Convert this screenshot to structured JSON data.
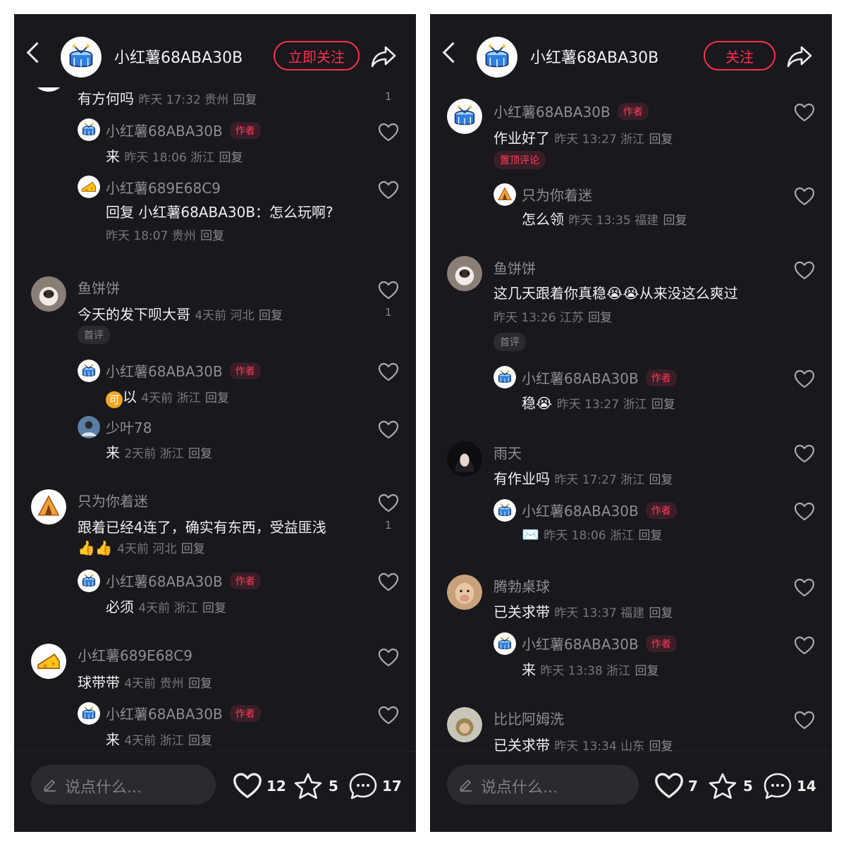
{
  "common": {
    "reply_label": "回复",
    "author_tag": "作者"
  },
  "left": {
    "header": {
      "title": "小红薯68ABA30B",
      "follow_label": "立即关注"
    },
    "comments": [
      {
        "name": "",
        "text": "有方何吗",
        "time": "昨天 17:32 贵州",
        "likes": "1"
      },
      {
        "name": "小红薯68ABA30B",
        "text": "来",
        "time": "昨天 18:06 浙江"
      },
      {
        "name": "小红薯689E68C9",
        "text": "回复  小红薯68ABA30B：怎么玩啊?",
        "time": "昨天 18:07 贵州"
      },
      {
        "name": "鱼饼饼",
        "text": "今天的发下呗大哥",
        "time": "4天前 河北",
        "likes": "1",
        "badge": "首评"
      },
      {
        "name": "小红薯68ABA30B",
        "text": "以",
        "time": "4天前 浙江",
        "emoji": "可"
      },
      {
        "name": "少叶78",
        "text": "来",
        "time": "2天前 浙江"
      },
      {
        "name": "只为你着迷",
        "text": "跟着已经4连了，确实有东西，受益匪浅",
        "text2": "👍👍",
        "time": "4天前 河北",
        "likes": "1"
      },
      {
        "name": "小红薯68ABA30B",
        "text": "必须",
        "time": "4天前 浙江"
      },
      {
        "name": "小红薯689E68C9",
        "text": "球带带",
        "time": "4天前 贵州"
      },
      {
        "name": "小红薯68ABA30B",
        "text": "来",
        "time": "4天前 浙江"
      }
    ],
    "footer": {
      "placeholder": "说点什么...",
      "likes": "12",
      "stars": "5",
      "comments": "17"
    }
  },
  "right": {
    "header": {
      "title": "小红薯68ABA30B",
      "follow_label": "关注"
    },
    "comments": [
      {
        "name": "小红薯68ABA30B",
        "text": "作业好了",
        "time": "昨天 13:27 浙江",
        "badge": "置顶评论"
      },
      {
        "name": "只为你着迷",
        "text": "怎么领",
        "time": "昨天 13:35 福建"
      },
      {
        "name": "鱼饼饼",
        "text": "这几天跟着你真稳😭😭从来没这么爽过",
        "time": "昨天 13:26 江苏",
        "badge": "首评"
      },
      {
        "name": "小红薯68ABA30B",
        "text": "稳😭",
        "time": "昨天 13:27 浙江"
      },
      {
        "name": "雨天",
        "text": "有作业吗",
        "time": "昨天 17:27 浙江"
      },
      {
        "name": "小红薯68ABA30B",
        "text": "✉️",
        "time": "昨天 18:06 浙江"
      },
      {
        "name": "腾勃桌球",
        "text": "已关求带",
        "time": "昨天 13:37 福建"
      },
      {
        "name": "小红薯68ABA30B",
        "text": "来",
        "time": "昨天 13:38 浙江"
      },
      {
        "name": "比比阿姆洗",
        "text": "已关求带",
        "time": "昨天 13:34 山东"
      }
    ],
    "footer": {
      "placeholder": "说点什么...",
      "likes": "7",
      "stars": "5",
      "comments": "14"
    }
  },
  "colors": {
    "accent": "#ff2e4d",
    "background": "#18181d",
    "tag_bg": "#3a1e27"
  },
  "icons": [
    "back-arrow-icon",
    "share-icon",
    "heart-icon",
    "star-icon",
    "comment-icon",
    "pen-icon"
  ]
}
